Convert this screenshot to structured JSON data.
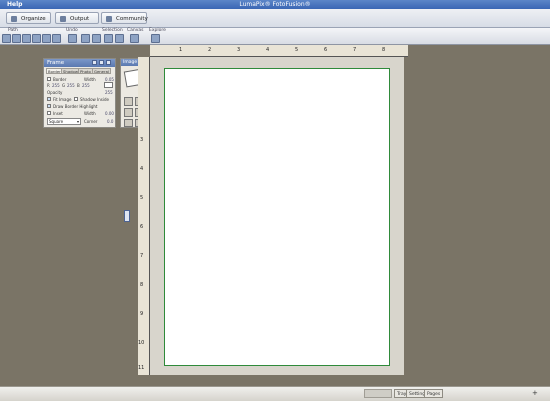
{
  "window": {
    "title": "LumaPix® FotoFusion®",
    "menu_help": "Help"
  },
  "tabs": [
    {
      "label": "Organize"
    },
    {
      "label": "Output"
    },
    {
      "label": "Community"
    }
  ],
  "toolbar": {
    "groups": [
      "Path",
      "Undo",
      "Selection",
      "Canvas",
      "Explore"
    ]
  },
  "frame_panel": {
    "title": "Frame",
    "tabs": [
      "Border",
      "Shadow",
      "Photo",
      "General"
    ],
    "border_label": "Border",
    "width_label": "Width",
    "width_value": "0.05",
    "rgb": [
      "255",
      "255",
      "255"
    ],
    "rgb_labels": [
      "R",
      "G",
      "B"
    ],
    "opacity_label": "Opacity",
    "opacity_value": "255",
    "fit_image": "Fit Image",
    "shadow_inside": "Shadow Inside",
    "draw_border_highlight": "Draw Border Highlight",
    "inset_label": "Inset",
    "inset_width_label": "Width",
    "inset_width_value": "0.00",
    "shape_value": "Square",
    "corner_label": "Corner",
    "corner_value": "0.0"
  },
  "image_panel": {
    "title": "Image"
  },
  "rulers": {
    "horizontal": [
      "1",
      "2",
      "3",
      "4",
      "5",
      "6",
      "7",
      "8"
    ],
    "vertical": [
      "3",
      "4",
      "5",
      "6",
      "7",
      "8",
      "9",
      "10",
      "11"
    ]
  },
  "status_bar": {
    "buttons": [
      "Tray",
      "Settings",
      "Pages"
    ]
  }
}
